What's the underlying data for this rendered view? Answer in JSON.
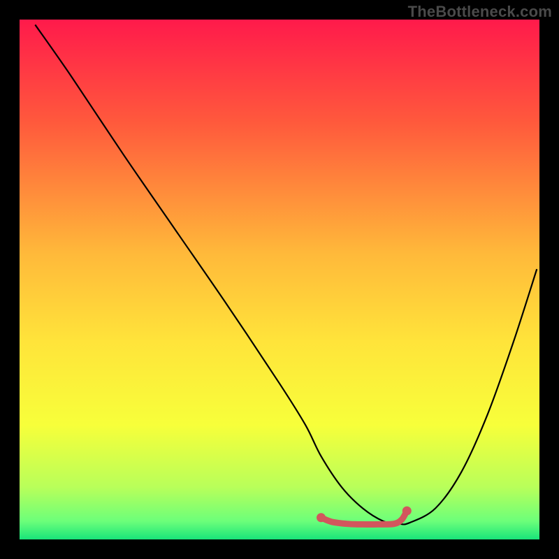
{
  "watermark": "TheBottleneck.com",
  "chart_data": {
    "type": "line",
    "title": "",
    "xlabel": "",
    "ylabel": "",
    "xlim": [
      0,
      100
    ],
    "ylim": [
      0,
      100
    ],
    "grid": false,
    "legend": false,
    "gradient_stops": [
      {
        "offset": 0.0,
        "color": "#ff1a4b"
      },
      {
        "offset": 0.2,
        "color": "#ff5a3c"
      },
      {
        "offset": 0.45,
        "color": "#ffb93a"
      },
      {
        "offset": 0.62,
        "color": "#ffe43a"
      },
      {
        "offset": 0.78,
        "color": "#f7ff3a"
      },
      {
        "offset": 0.9,
        "color": "#b8ff5a"
      },
      {
        "offset": 0.965,
        "color": "#6cff7a"
      },
      {
        "offset": 1.0,
        "color": "#18e47a"
      }
    ],
    "series": [
      {
        "name": "curve",
        "color": "#000000",
        "x": [
          3,
          10,
          20,
          30,
          40,
          50,
          55,
          58,
          62,
          66,
          70,
          73,
          75,
          80,
          85,
          90,
          95,
          99.5
        ],
        "y": [
          99,
          89,
          74,
          59.5,
          45,
          30,
          22,
          16,
          10,
          6,
          3.5,
          3,
          3.2,
          6,
          13,
          24,
          38,
          52
        ]
      },
      {
        "name": "optimum-marker",
        "color": "#d2565d",
        "x": [
          58,
          60,
          63,
          66,
          69,
          72,
          73.5,
          74.5
        ],
        "y": [
          4.2,
          3.4,
          3.0,
          2.9,
          2.9,
          3.0,
          3.8,
          5.5
        ]
      }
    ],
    "marker_endpoints": [
      {
        "x": 58,
        "y": 4.2
      },
      {
        "x": 74.5,
        "y": 5.5
      }
    ]
  }
}
